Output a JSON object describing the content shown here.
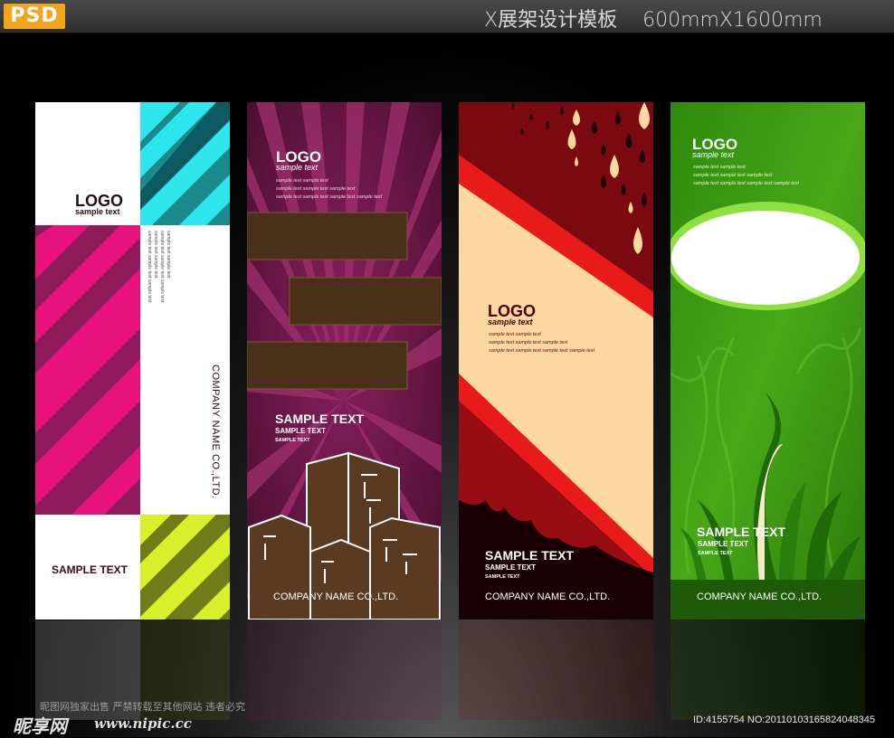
{
  "header": {
    "badge": "PSD",
    "title": "X展架设计模板",
    "size": "600mmX1600mm"
  },
  "panel1": {
    "logo": "LOGO",
    "logo_sub": "sample text",
    "vertical_lines": [
      "sample text sample text",
      "sample text sample text sample text",
      "sample text sample text",
      "sample text sample text sample text"
    ],
    "company": "COMPANY NAME CO.,LTD.",
    "sample": "SAMPLE TEXT",
    "colors": {
      "pink": "#e8127c",
      "purple": "#8e1a5c",
      "teal": "#1c8a8a",
      "cyan": "#2ee6ee",
      "olive": "#8a9a1a",
      "lime": "#d8f02a"
    }
  },
  "panel2": {
    "logo": "LOGO",
    "logo_sub": "sample text",
    "lines": [
      "sample text sample text",
      "sample text sample text sample text",
      "sample text sample text sample text sample text"
    ],
    "heading": "SAMPLE TEXT",
    "sub1": "SAMPLE TEXT",
    "sub2": "SAMPLE TEXT",
    "company": "COMPANY NAME CO.,LTD.",
    "colors": {
      "bg": "#6a1848",
      "ray": "#a02a6a",
      "block": "#4a3018",
      "city": "#5a3a20"
    }
  },
  "panel3": {
    "logo": "LOGO",
    "logo_sub": "sample text",
    "lines": [
      "sample text sample text",
      "sample text sample text sample text",
      "sample text sample text sample text sample text"
    ],
    "heading": "SAMPLE TEXT",
    "sub1": "SAMPLE TEXT",
    "sub2": "SAMPLE TEXT",
    "company": "COMPANY NAME CO.,LTD.",
    "colors": {
      "bg": "#7a0a10",
      "cream": "#fbd8a0",
      "red": "#e81a1a"
    }
  },
  "panel4": {
    "logo": "LOGO",
    "logo_sub": "sample text",
    "lines": [
      "sample text sample text",
      "sample text sample text sample text",
      "sample text sample text sample text sample text"
    ],
    "heading": "SAMPLE TEXT",
    "sub1": "SAMPLE TEXT",
    "sub2": "SAMPLE TEXT",
    "company": "COMPANY NAME CO.,LTD.",
    "colors": {
      "bg": "#3c9a10",
      "light": "#8ee040",
      "dark": "#1e5a08"
    }
  },
  "watermark": {
    "notice": "昵图网独家出售  严禁转载至其他网站  违者必究",
    "logo": "昵享网",
    "url": "www.nipic.cc",
    "id": "ID:4155754 NO:20110103165824048345"
  }
}
